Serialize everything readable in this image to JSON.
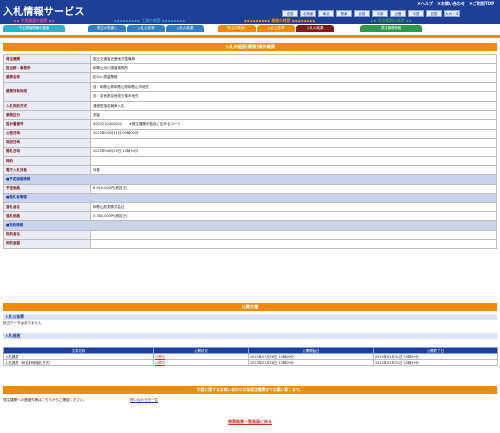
{
  "app": {
    "title": "入札情報サービス"
  },
  "top_links": [
    "＊ヘルプ",
    "＊お問い合わせ",
    "＊ご利用TOP"
  ],
  "regions": [
    "全国",
    "北海道",
    "東北",
    "関東",
    "北陸",
    "中部",
    "近畿",
    "中国",
    "四国",
    "九州・沖縄"
  ],
  "nav": {
    "groups": [
      {
        "title": "◆◆ 予定調達の検索 ◆◆",
        "color": "#d84a9a",
        "tabs": [
          {
            "label": "予定調達情報の検索",
            "color": "#2db0c8"
          }
        ]
      },
      {
        "title": "◆◆◆◆◆◆◆◆◆ 工事の検索 ◆◆◆◆◆◆◆◆",
        "color": "#3a8fd8",
        "tabs": [
          {
            "label": "発注の見通し",
            "color": "#2d80c8"
          },
          {
            "label": "入札公告等",
            "color": "#2d80c8"
          },
          {
            "label": "入札の結果",
            "color": "#2d80c8"
          }
        ]
      },
      {
        "title": "◆◆◆◆◆◆◆◆◆ 業務の検索 ◆◆◆◆◆◆◆◆",
        "color": "#f08a00",
        "tabs": [
          {
            "label": "発注の見通し",
            "color": "#f08a00"
          },
          {
            "label": "入札公告等",
            "color": "#f08a00"
          },
          {
            "label": "入札の結果",
            "color": "#7a1c1c",
            "active": true
          }
        ]
      },
      {
        "title": "◆◆ 発注機関の検索 ◆◆",
        "color": "#2d9a4a",
        "tabs": [
          {
            "label": "発注機関情報",
            "color": "#2d9a4a"
          }
        ]
      }
    ]
  },
  "section_title": "入札の経過(業務)案件概要",
  "detail": {
    "rows": [
      {
        "label": "発注機関",
        "value": "国土交通省近畿地方整備局"
      },
      {
        "label": "担当部・事務所",
        "value": "和歌山河川国道事務所"
      },
      {
        "label": "業務名称",
        "value": "紀の川測量業務"
      },
      {
        "label": "業務対象地域",
        "lines": [
          "自：和歌山県和歌山県和歌山市地先",
          "至：奈良県奈良県五條市地先"
        ]
      },
      {
        "label": "入札契約方式",
        "value": "通常型指名競争入札"
      },
      {
        "label": "業務区分",
        "value": "測量"
      },
      {
        "label": "設計書番号",
        "value": "0003210400002　　※発注機関が独自に定めるコード"
      },
      {
        "label": "公告日時",
        "value": "2023年05月11日 00時00分"
      },
      {
        "label": "現説日時",
        "value": ""
      },
      {
        "label": "開札日時",
        "value": "2023年06月15日 15時30分"
      },
      {
        "label": "特約",
        "value": ""
      },
      {
        "label": "電子入札対象",
        "value": "対象"
      }
    ],
    "price_group": "■予定価格情報",
    "price_rows": [
      {
        "label": "予定価格",
        "value": "8,910,000円(税抜き)"
      }
    ],
    "winner_group": "■落札者情報",
    "winner_rows": [
      {
        "label": "落札者名",
        "value": "和歌山航測株式会社"
      },
      {
        "label": "落札価格",
        "value": "5,380,000円(税抜き)"
      }
    ],
    "contract_group": "■契約情報",
    "contract_rows": [
      {
        "label": "契約者名",
        "value": ""
      },
      {
        "label": "契約金額",
        "value": ""
      }
    ]
  },
  "public_docs": {
    "title": "公開文書",
    "notice": {
      "heading": "入札公告等",
      "text": "該当データはありません"
    },
    "progress": {
      "heading": "入札経過",
      "columns": [
        "文書名称",
        "公開状況",
        "公開開始日",
        "公開終了日"
      ],
      "rows": [
        {
          "name": "入札調書",
          "status": "公開中",
          "start": "2023年07月28日 10時00分",
          "end": "2025年03月31日 23時59分"
        },
        {
          "name": "入札調書（総合評価落札方式）",
          "status": "公開中",
          "start": "2023年07月28日 10時00分",
          "end": "2025年03月31日 23時59分"
        }
      ]
    }
  },
  "contact": {
    "title": "内容に関するお問い合わせは各発注機関までお願い致します。",
    "text": "発注機関への連絡先等はこちらからご確認ください。",
    "link": "問い合わせ先一覧"
  },
  "back_link": "検索結果一覧画面に戻る",
  "colors": {
    "header": "#1e3f96",
    "accent": "#f08a00",
    "label": "#7a1c1c"
  }
}
